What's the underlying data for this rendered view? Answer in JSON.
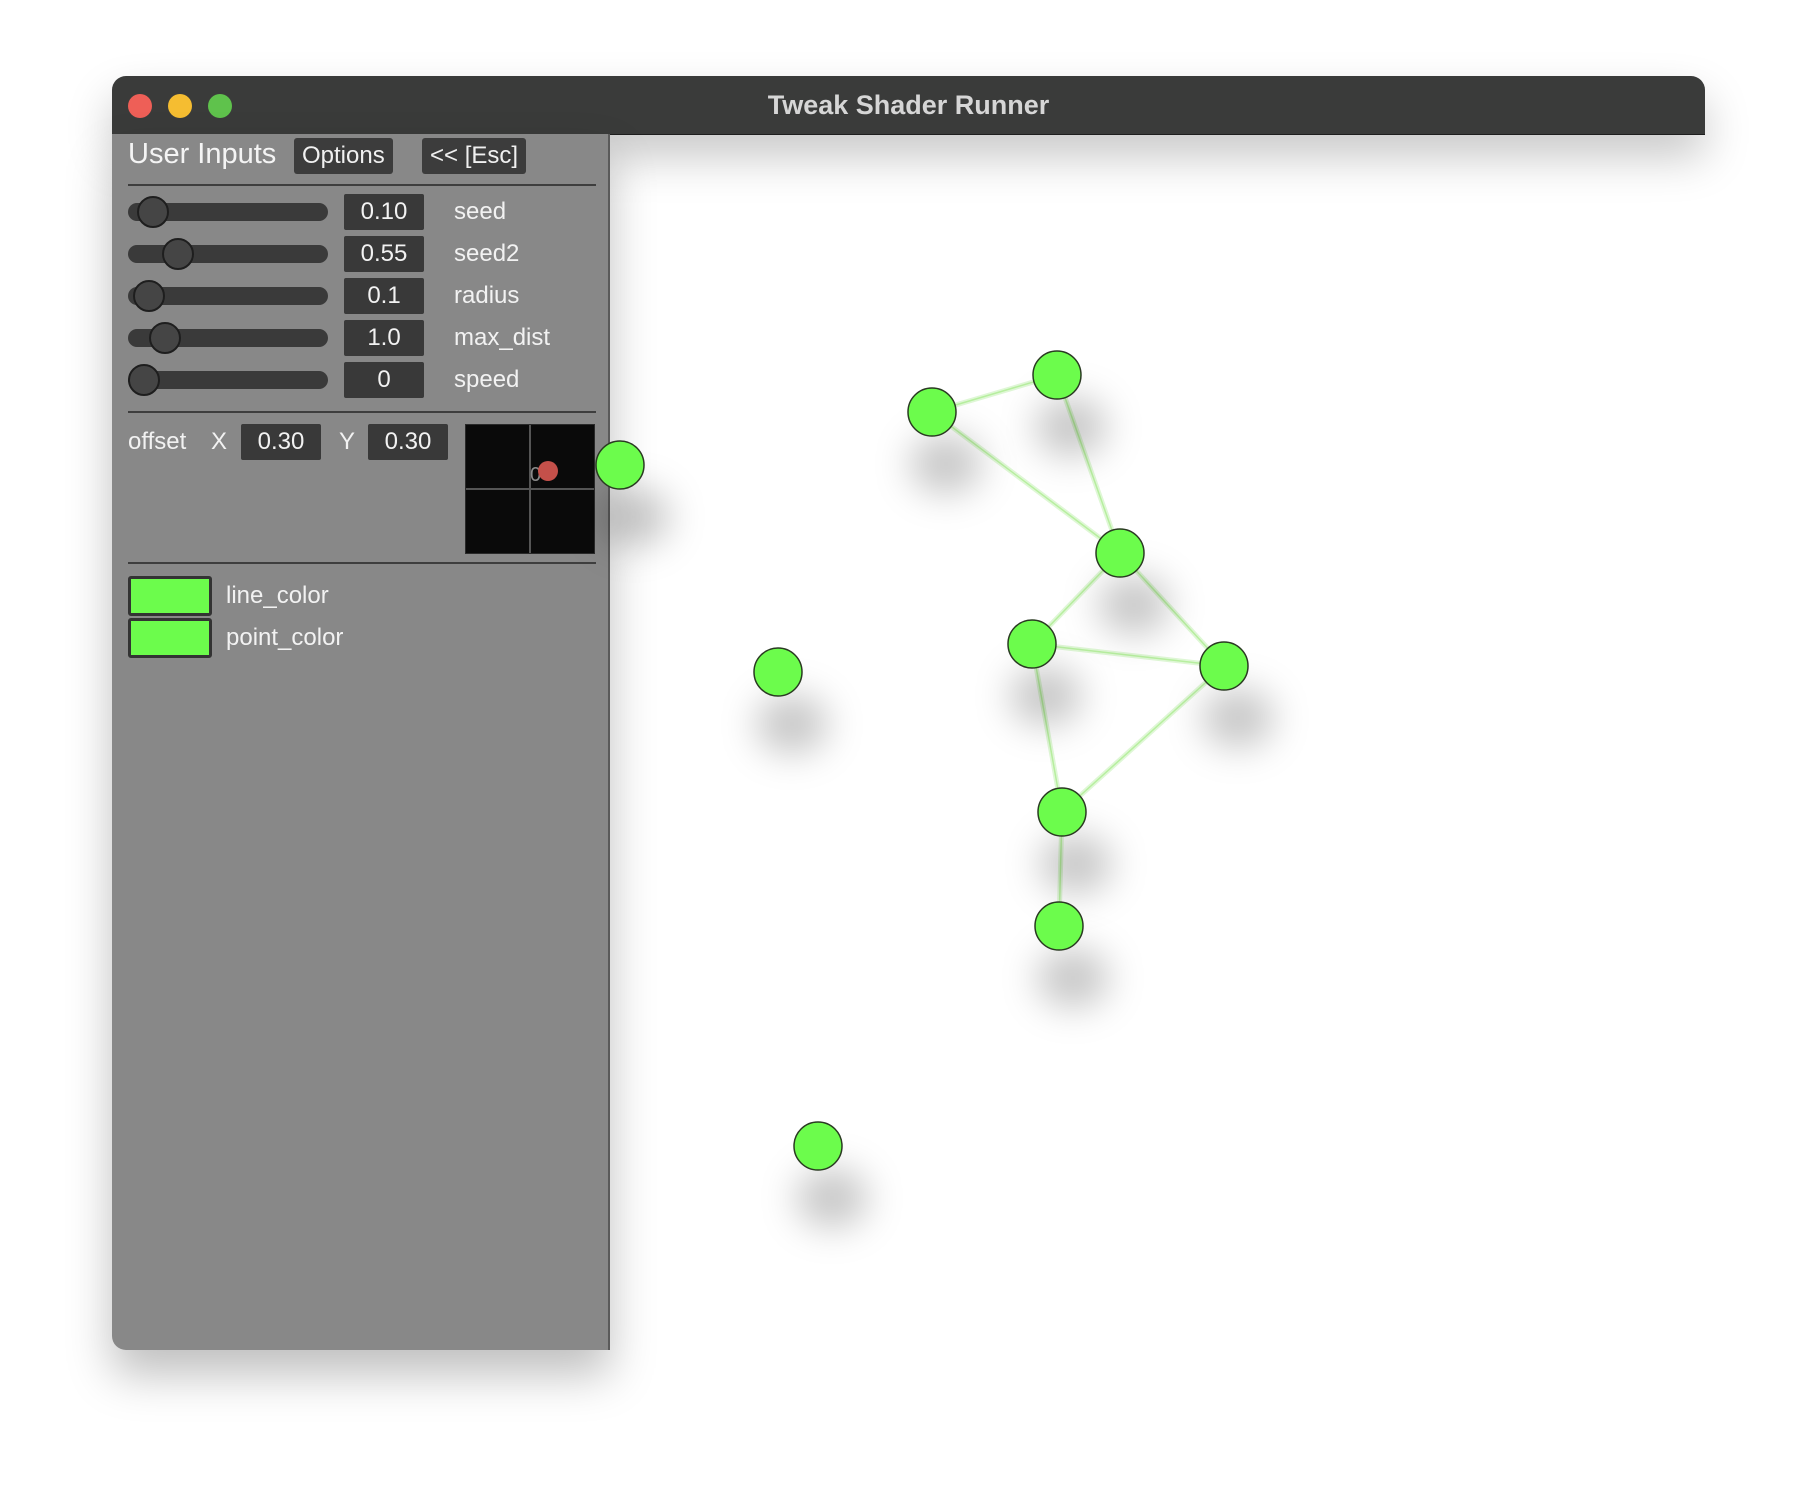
{
  "window": {
    "title": "Tweak Shader Runner"
  },
  "panel": {
    "title": "User Inputs",
    "options_label": "Options",
    "esc_label": "<< [Esc]",
    "sliders": [
      {
        "name": "seed",
        "value": "0.10",
        "fraction": 0.05
      },
      {
        "name": "seed2",
        "value": "0.55",
        "fraction": 0.2
      },
      {
        "name": "radius",
        "value": "0.1",
        "fraction": 0.03
      },
      {
        "name": "max_dist",
        "value": "1.0",
        "fraction": 0.12
      },
      {
        "name": "speed",
        "value": "0",
        "fraction": 0.0
      }
    ],
    "offset": {
      "label": "offset",
      "x_label": "X",
      "x_value": "0.30",
      "y_label": "Y",
      "y_value": "0.30",
      "cursor_glyph": "0"
    },
    "colors": [
      {
        "name": "line_color",
        "hex": "#6cfc4c"
      },
      {
        "name": "point_color",
        "hex": "#6cfc4c"
      }
    ]
  },
  "theme": {
    "point_color": "#6cfc4c",
    "line_color": "#dff7d6",
    "marker_color": "#c4504a"
  }
}
